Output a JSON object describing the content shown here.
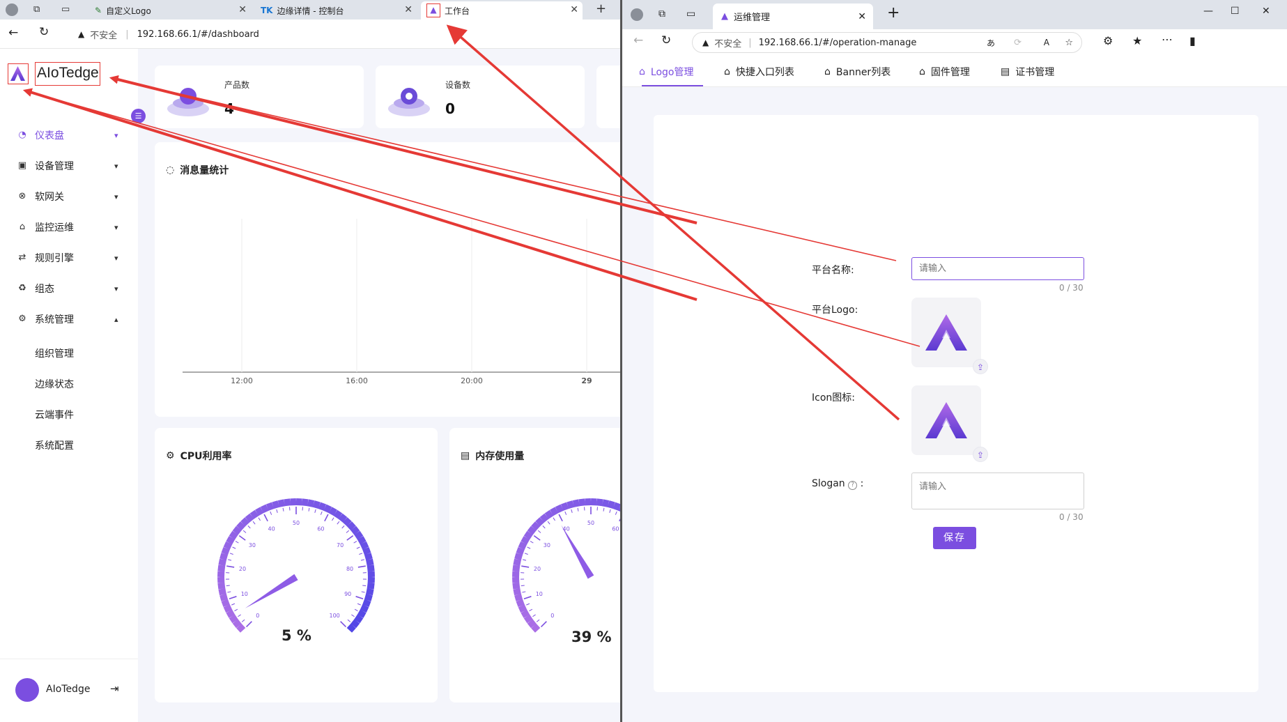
{
  "left_window": {
    "tabs": [
      {
        "label": "自定义Logo"
      },
      {
        "label": "边缘详情 - 控制台"
      },
      {
        "label": "工作台"
      }
    ],
    "address": {
      "warning": "不安全",
      "url": "192.168.66.1/#/dashboard"
    },
    "brand": {
      "name": "AIoTedge"
    },
    "menu": [
      {
        "label": "仪表盘"
      },
      {
        "label": "设备管理"
      },
      {
        "label": "软网关"
      },
      {
        "label": "监控运维"
      },
      {
        "label": "规则引擎"
      },
      {
        "label": "组态"
      },
      {
        "label": "系统管理"
      }
    ],
    "submenu": [
      {
        "label": "组织管理"
      },
      {
        "label": "边缘状态"
      },
      {
        "label": "云端事件"
      },
      {
        "label": "系统配置"
      }
    ],
    "user": {
      "name": "AIoTedge"
    },
    "stats": [
      {
        "label": "产品数",
        "value": "4"
      },
      {
        "label": "设备数",
        "value": "0"
      }
    ],
    "message_chart": {
      "title": "消息量统计",
      "x_ticks": [
        "12:00",
        "16:00",
        "20:00",
        "29"
      ]
    },
    "cpu": {
      "title": "CPU利用率",
      "value_text": "5 %",
      "value": 5,
      "ticks": [
        "0",
        "10",
        "20",
        "30",
        "40",
        "50",
        "60",
        "70",
        "80",
        "90",
        "100"
      ]
    },
    "memory": {
      "title": "内存使用量",
      "value_text": "39 %",
      "value": 39,
      "ticks": [
        "0",
        "10",
        "20",
        "30",
        "40",
        "50",
        "60"
      ]
    }
  },
  "right_window": {
    "tab": {
      "label": "运维管理"
    },
    "address": {
      "warning": "不安全",
      "url": "192.168.66.1/#/operation-manage"
    },
    "tabs": [
      {
        "label": "Logo管理"
      },
      {
        "label": "快捷入口列表"
      },
      {
        "label": "Banner列表"
      },
      {
        "label": "固件管理"
      },
      {
        "label": "证书管理"
      }
    ],
    "form": {
      "platform_name_label": "平台名称:",
      "platform_name_placeholder": "请输入",
      "platform_name_counter": "0 / 30",
      "platform_logo_label": "平台Logo:",
      "icon_label": "Icon图标:",
      "slogan_label": "Slogan",
      "slogan_colon": ":",
      "slogan_placeholder": "请输入",
      "slogan_counter": "0 / 30",
      "save_label": "保存"
    }
  },
  "colors": {
    "accent": "#7b4ee0",
    "annotation": "#e53935"
  }
}
